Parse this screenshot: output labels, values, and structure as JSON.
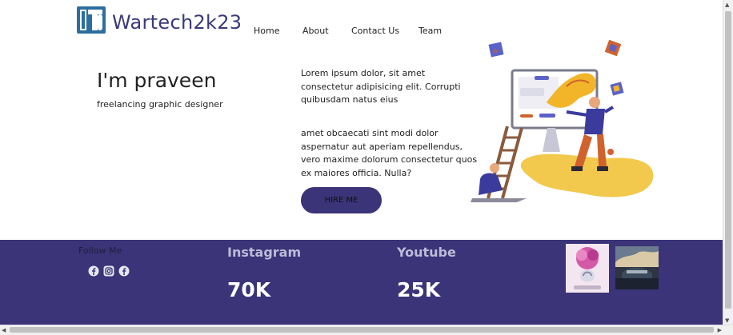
{
  "header": {
    "brand": "Wartech2k23",
    "nav": [
      "Home",
      "About",
      "Contact Us",
      "Team"
    ]
  },
  "hero": {
    "title": "I'm praveen",
    "subtitle": "freelancing graphic designer",
    "paragraph1": "Lorem ipsum dolor, sit amet consectetur adipisicing elit. Corrupti quibusdam natus eius",
    "paragraph2": "amet obcaecati sint modi dolor aspernatur aut aperiam repellendus, vero maxime dolorum consectetur quos ex maiores officia. Nulla?",
    "button": "HIRE ME"
  },
  "footer": {
    "follow": "Follow Me",
    "social_icons": [
      "facebook-icon",
      "instagram-icon",
      "facebook-icon"
    ],
    "stats": [
      {
        "label": "Instagram",
        "value": "70K"
      },
      {
        "label": "Youtube",
        "value": "25K"
      }
    ]
  },
  "colors": {
    "brand": "#3b3478",
    "band": "#3b3478",
    "accent": "#f0b429"
  }
}
